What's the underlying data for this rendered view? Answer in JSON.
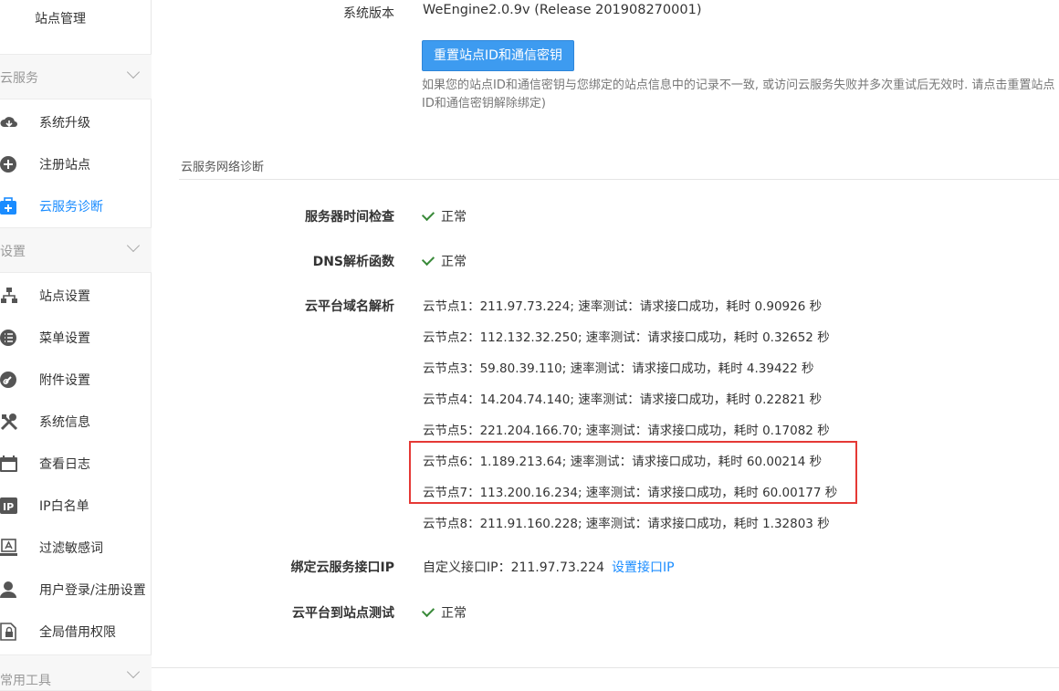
{
  "sidebar": {
    "top_item": "站点管理",
    "groups": [
      {
        "label": "云服务",
        "items": [
          {
            "label": "系统升级",
            "icon": "cloud-download-icon"
          },
          {
            "label": "注册站点",
            "icon": "plus-circle-icon"
          },
          {
            "label": "云服务诊断",
            "icon": "medkit-icon",
            "active": true
          }
        ]
      },
      {
        "label": "设置",
        "items": [
          {
            "label": "站点设置",
            "icon": "sitemap-icon"
          },
          {
            "label": "菜单设置",
            "icon": "list-icon"
          },
          {
            "label": "附件设置",
            "icon": "link-icon"
          },
          {
            "label": "系统信息",
            "icon": "tools-icon"
          },
          {
            "label": "查看日志",
            "icon": "calendar-icon"
          },
          {
            "label": "IP白名单",
            "icon": "ip-icon"
          },
          {
            "label": "过滤敏感词",
            "icon": "filter-icon"
          },
          {
            "label": "用户登录/注册设置",
            "icon": "user-icon"
          },
          {
            "label": "全局借用权限",
            "icon": "lock-file-icon"
          }
        ]
      },
      {
        "label": "常用工具",
        "items": []
      }
    ]
  },
  "main": {
    "version_label": "系统版本",
    "version_value": "WeEngine2.0.9v (Release 201908270001)",
    "reset_button": "重置站点ID和通信密钥",
    "reset_hint": "如果您的站点ID和通信密钥与您绑定的站点信息中的记录不一致, 或访问云服务失败并多次重试后无效时. 请点击重置站点ID和通信密钥解除绑定)",
    "section_title": "云服务网络诊断",
    "time_check_label": "服务器时间检查",
    "time_check_value": "正常",
    "dns_label": "DNS解析函数",
    "dns_value": "正常",
    "domain_label": "云平台域名解析",
    "nodes": [
      "云节点1：211.97.73.224; 速率测试：请求接口成功，耗时 0.90926 秒",
      "云节点2：112.132.32.250; 速率测试：请求接口成功，耗时 0.32652 秒",
      "云节点3：59.80.39.110; 速率测试：请求接口成功，耗时 4.39422 秒",
      "云节点4：14.204.74.140; 速率测试：请求接口成功，耗时 0.22821 秒",
      "云节点5：221.204.166.70; 速率测试：请求接口成功，耗时 0.17082 秒",
      "云节点6：1.189.213.64; 速率测试：请求接口成功，耗时 60.00214 秒",
      "云节点7：113.200.16.234; 速率测试：请求接口成功，耗时 60.00177 秒",
      "云节点8：211.91.160.228; 速率测试：请求接口成功，耗时 1.32803 秒"
    ],
    "bind_ip_label": "绑定云服务接口IP",
    "bind_ip_value": "自定义接口IP：211.97.73.224",
    "bind_ip_link": "设置接口IP",
    "site_test_label": "云平台到站点测试",
    "site_test_value": "正常"
  },
  "colors": {
    "accent": "#1a8cff",
    "button": "#3d9bf0",
    "ok": "#3a8a3a",
    "highlight": "#e53935"
  }
}
